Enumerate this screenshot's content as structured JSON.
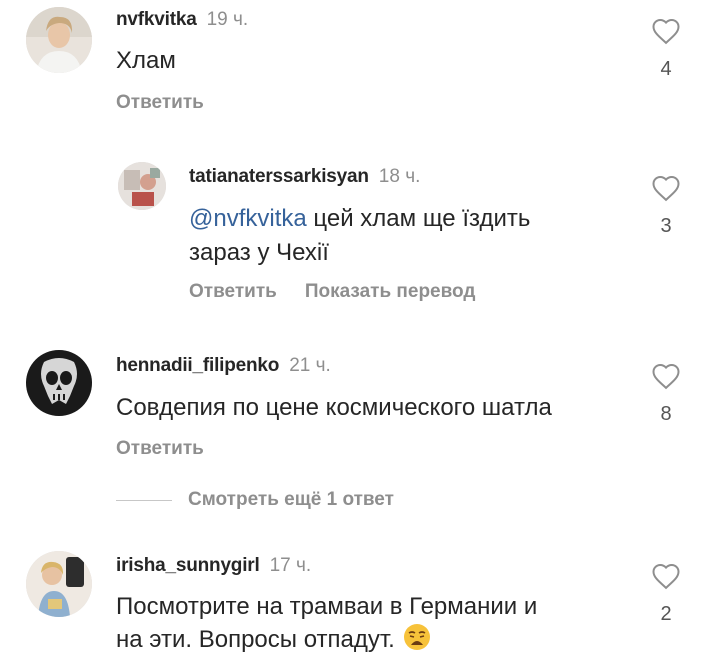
{
  "comments": [
    {
      "username": "nvfkvitka",
      "time": "19 ч.",
      "text": "Хлам",
      "reply_label": "Ответить",
      "likes": "4"
    },
    {
      "username": "tatianaterssarkisyan",
      "time": "18 ч.",
      "mention": "@nvfkvitka",
      "text_line1": " цей хлам ще їздить",
      "text_line2": "зараз у Чехії",
      "reply_label": "Ответить",
      "translate_label": "Показать перевод",
      "likes": "3"
    },
    {
      "username": "hennadii_filipenko",
      "time": "21 ч.",
      "text": "Совдепия по цене космического шатла",
      "reply_label": "Ответить",
      "likes": "8"
    },
    {
      "username": "irisha_sunnygirl",
      "time": "17 ч.",
      "text_line1": "Посмотрите на трамваи в Германии и",
      "text_line2": "на эти. Вопросы отпадут.",
      "likes": "2"
    }
  ],
  "more_replies": "Смотреть ещё 1 ответ",
  "colors": {
    "mention": "#36629a",
    "muted": "#8e8e8e",
    "text": "#262626"
  },
  "icons": {
    "like": "heart-outline-icon",
    "emoji": "weary-face-emoji"
  }
}
